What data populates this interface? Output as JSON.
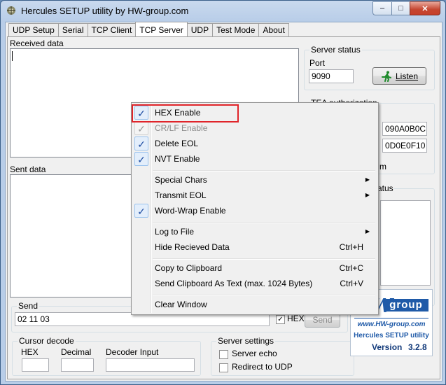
{
  "window": {
    "title": "Hercules SETUP utility by HW-group.com",
    "controls": {
      "minimize": "–",
      "maximize": "□",
      "close": "✕"
    }
  },
  "tabs": [
    "UDP Setup",
    "Serial",
    "TCP Client",
    "TCP Server",
    "UDP",
    "Test Mode",
    "About"
  ],
  "active_tab": "TCP Server",
  "received_label": "Received data",
  "sent_label": "Sent data",
  "server_status": {
    "title": "Server status",
    "port_label": "Port",
    "port_value": "9090",
    "listen_label": "Listen"
  },
  "tea": {
    "title": "TEA authorization",
    "key1": "090A0B0C",
    "key2": "0D0E0F10",
    "partial": "m"
  },
  "partial_status_label": "atus",
  "send": {
    "title": "Send",
    "value": "02 11 03",
    "hex_label": "HEX",
    "send_button": "Send"
  },
  "cursor_decode": {
    "title": "Cursor decode",
    "hex_label": "HEX",
    "decimal_label": "Decimal",
    "decoder_label": "Decoder Input"
  },
  "server_settings": {
    "title": "Server settings",
    "echo_label": "Server echo",
    "redirect_label": "Redirect to UDP"
  },
  "logo": {
    "brand_hw": "HW",
    "brand_group": "group",
    "url": "www.HW-group.com",
    "product": "Hercules SETUP utility",
    "version_label": "Version",
    "version": "3.2.8",
    "accent": "#1f5aa8"
  },
  "context_menu": {
    "items": [
      {
        "label": "HEX Enable",
        "checked": true
      },
      {
        "label": "CR/LF Enable",
        "checked": true,
        "disabled": true
      },
      {
        "label": "Delete EOL",
        "checked": true
      },
      {
        "label": "NVT Enable",
        "checked": true
      },
      {
        "label": "Special Chars",
        "submenu": true
      },
      {
        "label": "Transmit EOL",
        "submenu": true
      },
      {
        "label": "Word-Wrap Enable",
        "checked": true
      },
      {
        "label": "Log to File",
        "submenu": true
      },
      {
        "label": "Hide Recieved Data",
        "shortcut": "Ctrl+H"
      },
      {
        "label": "Copy to Clipboard",
        "shortcut": "Ctrl+C"
      },
      {
        "label": "Send Clipboard As Text (max. 1024 Bytes)",
        "shortcut": "Ctrl+V"
      },
      {
        "label": "Clear Window"
      }
    ],
    "check_glyph": "✓",
    "arrow_glyph": "▶"
  }
}
